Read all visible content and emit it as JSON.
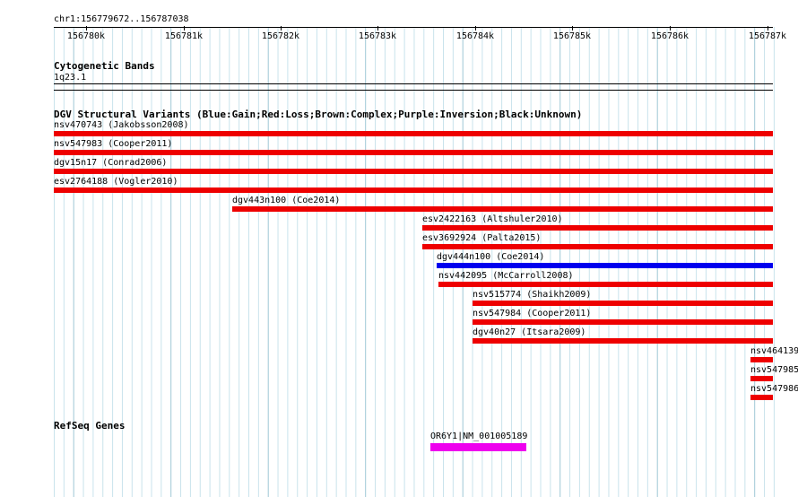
{
  "locus": "chr1:156779672..156787038",
  "ruler": {
    "ticks": [
      "156780k",
      "156781k",
      "156782k",
      "156783k",
      "156784k",
      "156785k",
      "156786k",
      "156787k"
    ]
  },
  "cytobands": {
    "title": "Cytogenetic Bands",
    "band_label": "1q23.1"
  },
  "dgv": {
    "title": "DGV Structural Variants (Blue:Gain;Red:Loss;Brown:Complex;Purple:Inversion;Black:Unknown)",
    "colors": {
      "gain": "#0000ee",
      "loss": "#ee0000"
    },
    "variants": [
      {
        "label": "nsv470743 (Jakobsson2008)",
        "type": "loss"
      },
      {
        "label": "nsv547983 (Cooper2011)",
        "type": "loss"
      },
      {
        "label": "dgv15n17 (Conrad2006)",
        "type": "loss"
      },
      {
        "label": "esv2764188 (Vogler2010)",
        "type": "loss"
      },
      {
        "label": "dgv443n100 (Coe2014)",
        "type": "loss"
      },
      {
        "label": "esv2422163 (Altshuler2010)",
        "type": "loss"
      },
      {
        "label": "esv3692924 (Palta2015)",
        "type": "loss"
      },
      {
        "label": "dgv444n100 (Coe2014)",
        "type": "gain"
      },
      {
        "label": "nsv442095 (McCarroll2008)",
        "type": "loss"
      },
      {
        "label": "nsv515774 (Shaikh2009)",
        "type": "loss"
      },
      {
        "label": "nsv547984 (Cooper2011)",
        "type": "loss"
      },
      {
        "label": "dgv40n27 (Itsara2009)",
        "type": "loss"
      },
      {
        "label": "nsv464139",
        "type": "loss"
      },
      {
        "label": "nsv547985",
        "type": "loss"
      },
      {
        "label": "nsv547986",
        "type": "loss"
      }
    ]
  },
  "refseq": {
    "title": "RefSeq Genes",
    "genes": [
      {
        "label": "OR6Y1|NM_001005189",
        "color": "#ee00ee"
      }
    ]
  }
}
